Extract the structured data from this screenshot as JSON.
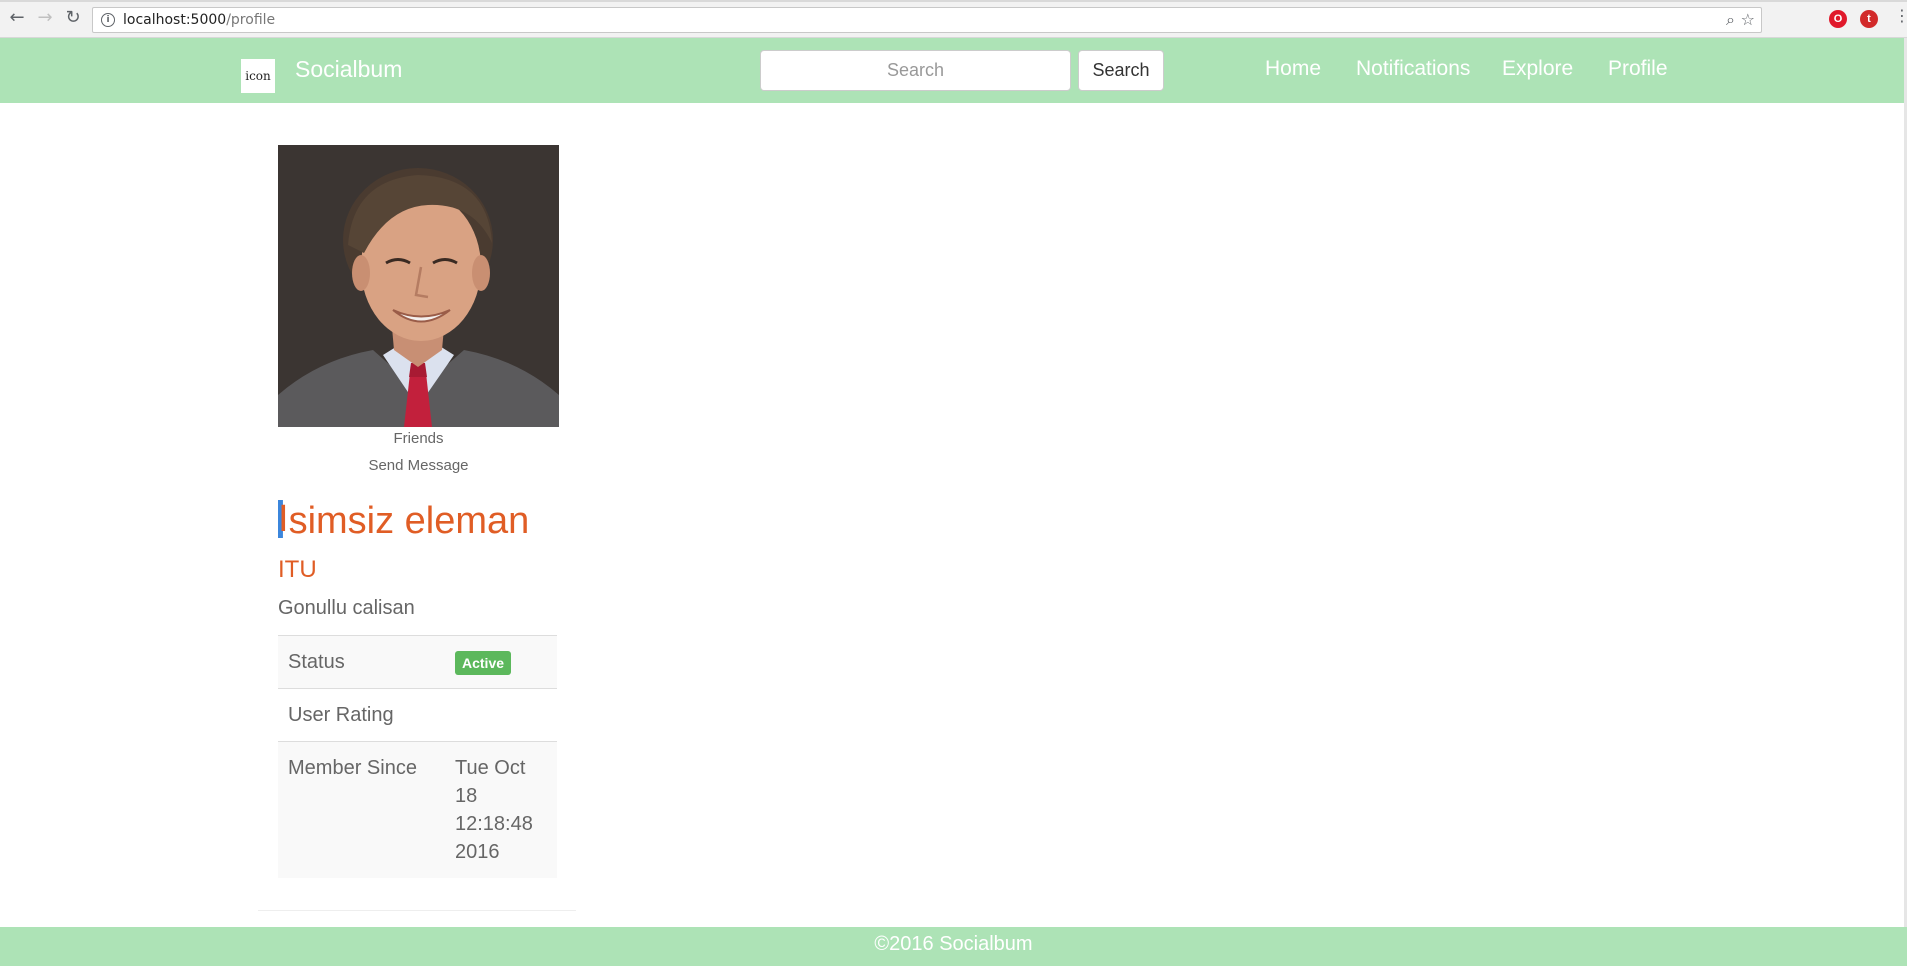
{
  "browser": {
    "url_host": "localhost:5000",
    "url_path": "/profile"
  },
  "navbar": {
    "logo_text": "icon",
    "brand": "Socialbum",
    "search": {
      "placeholder": "Search",
      "button_label": "Search"
    },
    "links": [
      "Home",
      "Notifications",
      "Explore",
      "Profile"
    ]
  },
  "profile": {
    "links": {
      "friends": "Friends",
      "send_message": "Send Message"
    },
    "name_first_char": "I",
    "name_rest": "simsiz eleman",
    "school": "ITU",
    "bio": "Gonullu calisan",
    "details": {
      "status_label": "Status",
      "status_value": "Active",
      "rating_label": "User Rating",
      "rating_value": "",
      "member_since_label": "Member Since",
      "member_since_value": "Tue Oct 18 12:18:48 2016"
    }
  },
  "footer": {
    "text": "©2016 Socialbum"
  },
  "colors": {
    "navbar_bg": "#ade3b6",
    "name_accent": "#e05d25",
    "badge_success": "#5cb85c"
  }
}
